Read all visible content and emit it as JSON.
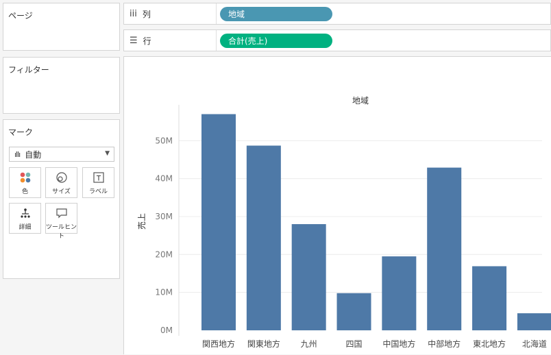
{
  "left_panels": {
    "pages_title": "ページ",
    "filters_title": "フィルター",
    "marks_title": "マーク",
    "mark_type": "自動",
    "mark_buttons": [
      {
        "label": "色",
        "icon": "color-dots-icon"
      },
      {
        "label": "サイズ",
        "icon": "size-icon"
      },
      {
        "label": "ラベル",
        "icon": "label-icon"
      },
      {
        "label": "詳細",
        "icon": "detail-icon"
      },
      {
        "label": "ツールヒント",
        "icon": "tooltip-icon"
      }
    ]
  },
  "shelves": {
    "columns_label": "列",
    "columns_pill": "地域",
    "rows_label": "行",
    "rows_pill": "合計(売上)",
    "columns_pill_color": "#4a97b2",
    "rows_pill_color": "#00b180"
  },
  "chart_data": {
    "type": "bar",
    "title": "地域",
    "ylabel": "売上",
    "categories": [
      "関西地方",
      "関東地方",
      "九州",
      "四国",
      "中国地方",
      "中部地方",
      "東北地方",
      "北海道"
    ],
    "values": [
      57000000,
      48700000,
      28000000,
      9800000,
      19500000,
      42900000,
      16900000,
      4500000
    ],
    "ylim": [
      0,
      58000000
    ],
    "yticks": [
      0,
      10000000,
      20000000,
      30000000,
      40000000,
      50000000
    ],
    "ytick_labels": [
      "0M",
      "10M",
      "20M",
      "30M",
      "40M",
      "50M"
    ],
    "bar_color": "#4e79a7",
    "grid": true
  }
}
